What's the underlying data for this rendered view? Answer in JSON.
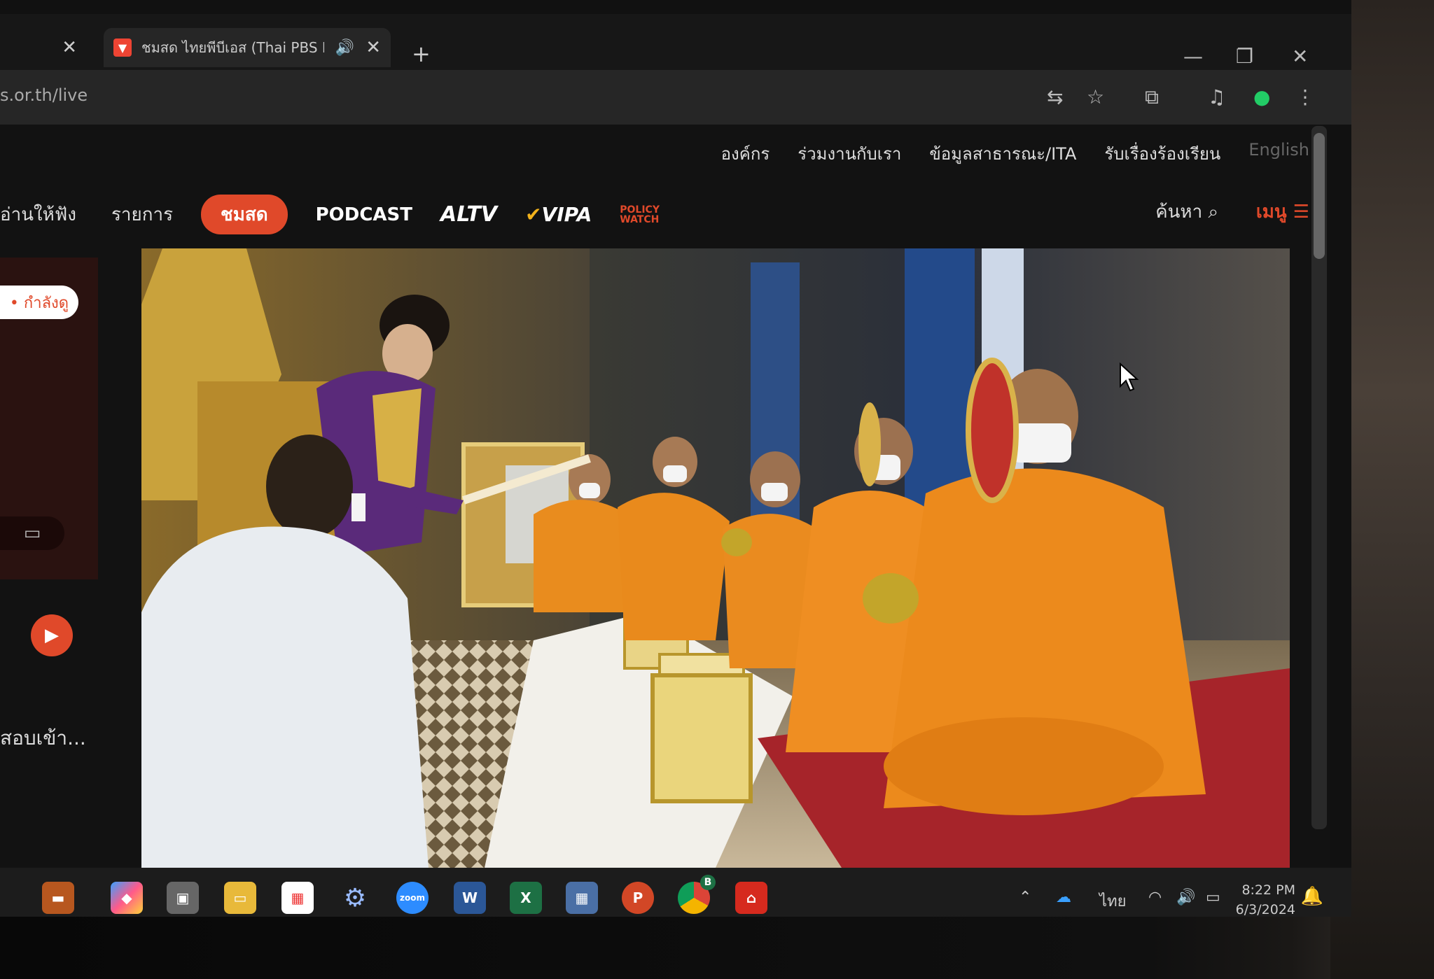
{
  "browser": {
    "active_tab_title": "ชมสด ไทยพีบีเอส (Thai PBS Li",
    "url": "s.or.th/live",
    "new_tab_label": "+",
    "close_label": "✕"
  },
  "site": {
    "top_nav": [
      "องค์กร",
      "ร่วมงานกับเรา",
      "ข้อมูลสาธารณะ/ITA",
      "รับเรื่องร้องเรียน",
      "English"
    ],
    "main_nav": {
      "read_aloud": "อ่านให้ฟัง",
      "programs": "รายการ",
      "live": "ชมสด",
      "podcast": "PODCAST",
      "altv": "ALTV",
      "vipa": "VIPA",
      "policy_watch": "POLICY WATCH"
    },
    "search_label": "ค้นหา",
    "menu_label": "เมนู"
  },
  "sidebar": {
    "watching_label": "• กำลังดู",
    "program_title": "สอบเข้า..."
  },
  "taskbar": {
    "language": "ไทย",
    "time": "8:22 PM",
    "date": "6/3/2024",
    "chrome_badge": "B"
  },
  "colors": {
    "accent": "#e0492a",
    "robe": "#e88a1e",
    "gold": "#d9b24a"
  }
}
